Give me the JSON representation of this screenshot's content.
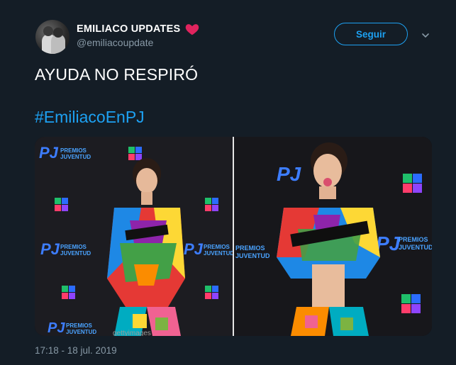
{
  "user": {
    "display_name": "EMILIACO UPDATES",
    "handle": "@emiliacoupdate"
  },
  "follow_button": {
    "label": "Seguir"
  },
  "tweet": {
    "text": "AYUDA NO RESPIRÓ",
    "hashtag": "#EmiliacoEnPJ",
    "timestamp": "17:18 - 18 jul. 2019"
  },
  "media": {
    "photos": [
      {
        "description": "photo-left"
      },
      {
        "description": "photo-right"
      }
    ],
    "logo_text_1": "PREMIOS",
    "logo_text_2": "JUVENTUD",
    "logo_mark": "PJ",
    "watermark": "gettyimages"
  },
  "colors": {
    "background": "#141d26",
    "accent": "#1da1f2",
    "secondary_text": "#8899a6",
    "heart": "#e0245e"
  }
}
